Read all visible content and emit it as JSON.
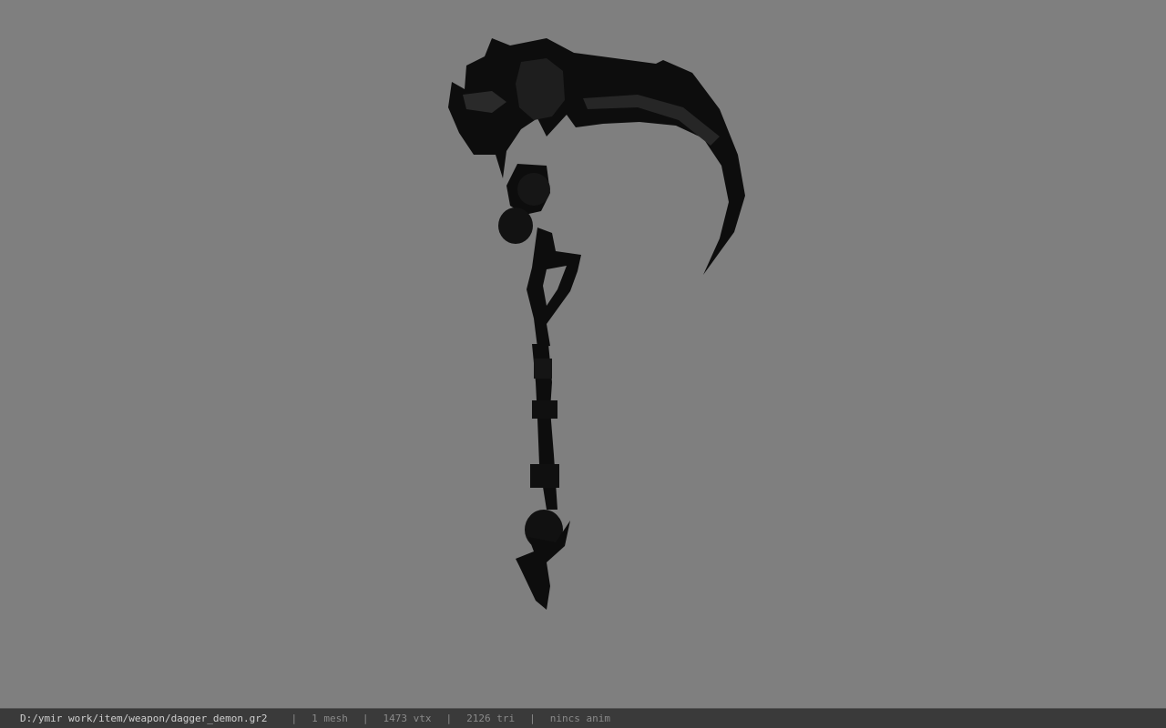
{
  "viewer": {
    "background_color": "#7f7f7f",
    "model_color": "#0d0d0d",
    "model_highlight_color": "#262626"
  },
  "status_bar": {
    "file_path": "D:/ymir work/item/weapon/dagger_demon.gr2",
    "mesh_count": "1 mesh",
    "vertex_count": "1473 vtx",
    "triangle_count": "2126 tri",
    "animation": "nincs anim",
    "separator": "|"
  }
}
